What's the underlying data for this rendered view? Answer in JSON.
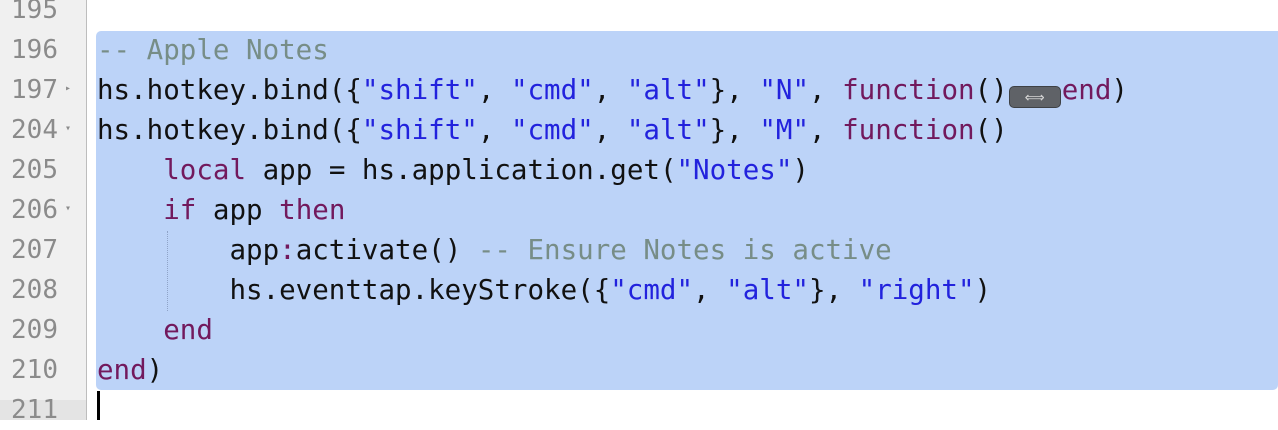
{
  "editor": {
    "fold_badge": "⟺",
    "lines": [
      {
        "number": "195",
        "fold": "",
        "tokens": []
      },
      {
        "number": "196",
        "fold": "",
        "tokens": [
          {
            "t": "cm",
            "v": "-- Apple Notes"
          }
        ]
      },
      {
        "number": "197",
        "fold": "▸",
        "tokens": [
          {
            "t": "pl",
            "v": "hs.hotkey.bind({"
          },
          {
            "t": "str",
            "v": "\"shift\""
          },
          {
            "t": "pl",
            "v": ", "
          },
          {
            "t": "str",
            "v": "\"cmd\""
          },
          {
            "t": "pl",
            "v": ", "
          },
          {
            "t": "str",
            "v": "\"alt\""
          },
          {
            "t": "pl",
            "v": "}, "
          },
          {
            "t": "str",
            "v": "\"N\""
          },
          {
            "t": "pl",
            "v": ", "
          },
          {
            "t": "kw",
            "v": "function"
          },
          {
            "t": "pl",
            "v": "()"
          },
          {
            "t": "badge",
            "v": ""
          },
          {
            "t": "kw",
            "v": "end"
          },
          {
            "t": "pl",
            "v": ")"
          }
        ]
      },
      {
        "number": "204",
        "fold": "▾",
        "tokens": [
          {
            "t": "pl",
            "v": "hs.hotkey.bind({"
          },
          {
            "t": "str",
            "v": "\"shift\""
          },
          {
            "t": "pl",
            "v": ", "
          },
          {
            "t": "str",
            "v": "\"cmd\""
          },
          {
            "t": "pl",
            "v": ", "
          },
          {
            "t": "str",
            "v": "\"alt\""
          },
          {
            "t": "pl",
            "v": "}, "
          },
          {
            "t": "str",
            "v": "\"M\""
          },
          {
            "t": "pl",
            "v": ", "
          },
          {
            "t": "kw",
            "v": "function"
          },
          {
            "t": "pl",
            "v": "()"
          }
        ]
      },
      {
        "number": "205",
        "fold": "",
        "tokens": [
          {
            "t": "pl",
            "v": "    "
          },
          {
            "t": "kw",
            "v": "local"
          },
          {
            "t": "pl",
            "v": " app = hs.application.get("
          },
          {
            "t": "str",
            "v": "\"Notes\""
          },
          {
            "t": "pl",
            "v": ")"
          }
        ]
      },
      {
        "number": "206",
        "fold": "▾",
        "tokens": [
          {
            "t": "pl",
            "v": "    "
          },
          {
            "t": "kw",
            "v": "if"
          },
          {
            "t": "pl",
            "v": " app "
          },
          {
            "t": "kw",
            "v": "then"
          }
        ]
      },
      {
        "number": "207",
        "fold": "",
        "tokens": [
          {
            "t": "pl",
            "v": "        app"
          },
          {
            "t": "kw",
            "v": ":"
          },
          {
            "t": "pl",
            "v": "activate() "
          },
          {
            "t": "cm",
            "v": "-- Ensure Notes is active"
          }
        ]
      },
      {
        "number": "208",
        "fold": "",
        "tokens": [
          {
            "t": "pl",
            "v": "        hs.eventtap.keyStroke({"
          },
          {
            "t": "str",
            "v": "\"cmd\""
          },
          {
            "t": "pl",
            "v": ", "
          },
          {
            "t": "str",
            "v": "\"alt\""
          },
          {
            "t": "pl",
            "v": "}, "
          },
          {
            "t": "str",
            "v": "\"right\""
          },
          {
            "t": "pl",
            "v": ")"
          }
        ]
      },
      {
        "number": "209",
        "fold": "",
        "tokens": [
          {
            "t": "pl",
            "v": "    "
          },
          {
            "t": "kw",
            "v": "end"
          }
        ]
      },
      {
        "number": "210",
        "fold": "",
        "tokens": [
          {
            "t": "kw",
            "v": "end"
          },
          {
            "t": "pl",
            "v": ")"
          }
        ]
      },
      {
        "number": "211",
        "fold": "",
        "tokens": []
      }
    ]
  }
}
